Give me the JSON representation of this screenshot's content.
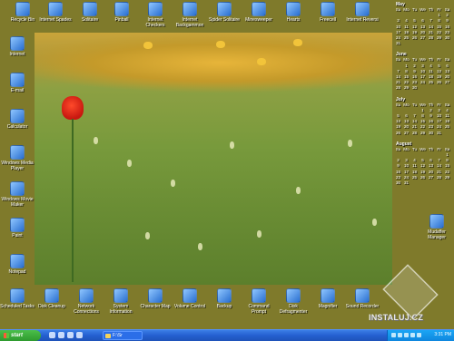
{
  "desktop": {
    "top_icons": [
      {
        "label": "Recycle Bin",
        "icon": "recycle-bin-icon"
      },
      {
        "label": "Internet Spades",
        "icon": "spades-icon"
      },
      {
        "label": "Solitaire",
        "icon": "solitaire-icon"
      },
      {
        "label": "Pinball",
        "icon": "pinball-icon"
      },
      {
        "label": "Internet Checkers",
        "icon": "checkers-icon"
      },
      {
        "label": "Internet Backgammon",
        "icon": "backgammon-icon"
      },
      {
        "label": "Spider Solitaire",
        "icon": "spider-solitaire-icon"
      },
      {
        "label": "Minesweeper",
        "icon": "minesweeper-icon"
      },
      {
        "label": "Hearts",
        "icon": "hearts-icon"
      },
      {
        "label": "Freecell",
        "icon": "freecell-icon"
      },
      {
        "label": "Internet Reversi",
        "icon": "reversi-icon"
      }
    ],
    "left_icons": [
      {
        "label": "Internet",
        "icon": "internet-icon"
      },
      {
        "label": "E-mail",
        "icon": "email-icon"
      },
      {
        "label": "Calculator",
        "icon": "calculator-icon"
      },
      {
        "label": "Windows Media Player",
        "icon": "media-player-icon"
      },
      {
        "label": "Windows Movie Maker",
        "icon": "movie-maker-icon"
      },
      {
        "label": "Paint",
        "icon": "paint-icon"
      },
      {
        "label": "Notepad",
        "icon": "notepad-icon"
      },
      {
        "label": "Scheduled Tasks",
        "icon": "scheduled-tasks-icon"
      }
    ],
    "bottom_icons": [
      {
        "label": "Disk Cleanup",
        "icon": "disk-cleanup-icon"
      },
      {
        "label": "Network Connections",
        "icon": "network-icon"
      },
      {
        "label": "System Information",
        "icon": "system-info-icon"
      },
      {
        "label": "Character Map",
        "icon": "character-map-icon"
      },
      {
        "label": "Volume Control",
        "icon": "volume-icon"
      },
      {
        "label": "Backup",
        "icon": "backup-icon"
      },
      {
        "label": "Command Prompt",
        "icon": "command-prompt-icon"
      },
      {
        "label": "Disk Defragmenter",
        "icon": "defrag-icon"
      },
      {
        "label": "Magnifier",
        "icon": "magnifier-icon"
      },
      {
        "label": "Sound Recorder",
        "icon": "sound-recorder-icon"
      }
    ],
    "right_icon": {
      "label": "Mudaffer Manager",
      "icon": "manager-icon"
    }
  },
  "calendar": {
    "dow": [
      "Su",
      "Mo",
      "Tu",
      "We",
      "Th",
      "Fr",
      "Sa"
    ],
    "months": [
      {
        "name": "May",
        "days": [
          "",
          "",
          "",
          "",
          "",
          "1",
          "2",
          "3",
          "4",
          "5",
          "6",
          "7",
          "8",
          "9",
          "10",
          "11",
          "12",
          "13",
          "14",
          "15",
          "16",
          "17",
          "18",
          "19",
          "20",
          "21",
          "22",
          "23",
          "24",
          "25",
          "26",
          "27",
          "28",
          "29",
          "30",
          "31",
          "",
          "",
          "",
          "",
          "",
          ""
        ]
      },
      {
        "name": "June",
        "days": [
          "",
          "1",
          "2",
          "3",
          "4",
          "5",
          "6",
          "7",
          "8",
          "9",
          "10",
          "11",
          "12",
          "13",
          "14",
          "15",
          "16",
          "17",
          "18",
          "19",
          "20",
          "21",
          "22",
          "23",
          "24",
          "25",
          "26",
          "27",
          "28",
          "29",
          "30",
          "",
          "",
          "",
          ""
        ]
      },
      {
        "name": "July",
        "days": [
          "",
          "",
          "",
          "1",
          "2",
          "3",
          "4",
          "5",
          "6",
          "7",
          "8",
          "9",
          "10",
          "11",
          "12",
          "13",
          "14",
          "15",
          "16",
          "17",
          "18",
          "19",
          "20",
          "21",
          "22",
          "23",
          "24",
          "25",
          "26",
          "27",
          "28",
          "29",
          "30",
          "31",
          ""
        ]
      },
      {
        "name": "August",
        "days": [
          "",
          "",
          "",
          "",
          "",
          "",
          "1",
          "2",
          "3",
          "4",
          "5",
          "6",
          "7",
          "8",
          "9",
          "10",
          "11",
          "12",
          "13",
          "14",
          "15",
          "16",
          "17",
          "18",
          "19",
          "20",
          "21",
          "22",
          "23",
          "24",
          "25",
          "26",
          "27",
          "28",
          "29",
          "30",
          "31",
          "",
          "",
          "",
          "",
          ""
        ]
      }
    ]
  },
  "watermark": {
    "text": "INSTALUJ.CZ"
  },
  "taskbar": {
    "start_label": "start",
    "task_button_label": "F:\\Sr",
    "clock": "3:31 PM"
  }
}
